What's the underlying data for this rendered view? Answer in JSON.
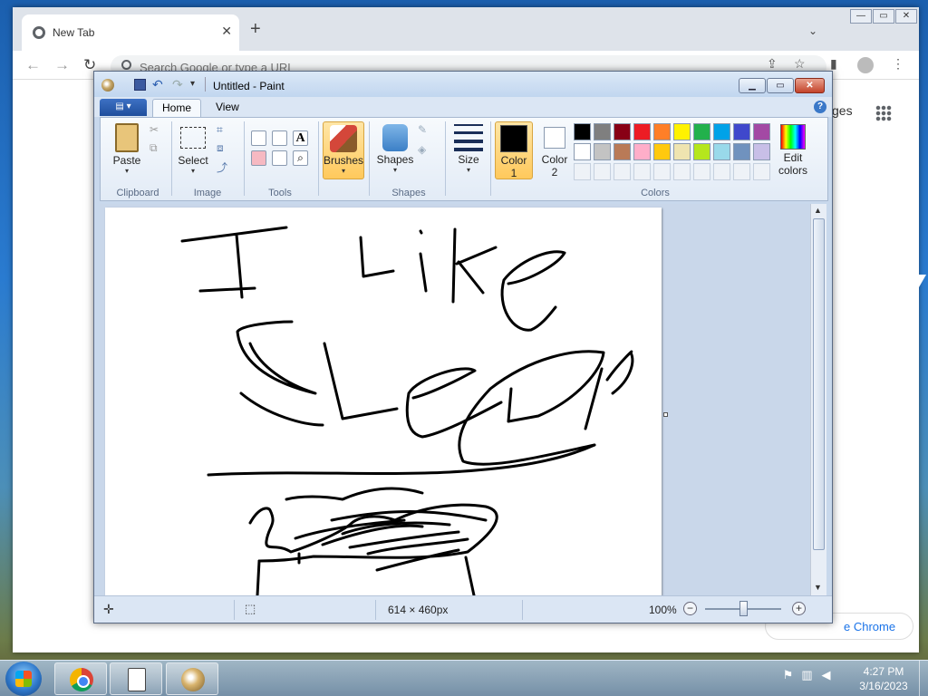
{
  "browser": {
    "tab_title": "New Tab",
    "tab_close": "✕",
    "new_tab": "+",
    "omnibox_placeholder": "Search Google or type a URL",
    "images_link": "ges",
    "customize_label": "e Chrome",
    "caption": {
      "minimize": "—",
      "maximize": "▭",
      "close": "✕"
    }
  },
  "paint": {
    "title": "Untitled - Paint",
    "menu_tabs": {
      "file": "▤ ▾",
      "home": "Home",
      "view": "View"
    },
    "ribbon": {
      "clipboard": {
        "paste": "Paste",
        "group": "Clipboard"
      },
      "image": {
        "select": "Select",
        "group": "Image"
      },
      "tools": {
        "group": "Tools"
      },
      "brushes": "Brushes",
      "shapes": {
        "shapes": "Shapes",
        "group": "Shapes"
      },
      "size": "Size",
      "colors": {
        "color1_label": "Color",
        "color1_num": "1",
        "color2_label": "Color",
        "color2_num": "2",
        "edit_colors_1": "Edit",
        "edit_colors_2": "colors",
        "group": "Colors",
        "color1": "#000000",
        "color2": "#ffffff",
        "palette_row1": [
          "#000000",
          "#7f7f7f",
          "#880015",
          "#ed1c24",
          "#ff7f27",
          "#fff200",
          "#22b14c",
          "#00a2e8",
          "#3f48cc",
          "#a349a4"
        ],
        "palette_row2": [
          "#ffffff",
          "#c3c3c3",
          "#b97a57",
          "#ffaec9",
          "#ffc90e",
          "#efe4b0",
          "#b5e61d",
          "#99d9ea",
          "#7092be",
          "#c8bfe7"
        ]
      }
    },
    "canvas_text": "I Like Sleep",
    "status": {
      "canvas_size": "614 × 460px",
      "zoom": "100%",
      "zoom_minus": "−",
      "zoom_plus": "+"
    }
  },
  "taskbar": {
    "time": "4:27 PM",
    "date": "3/16/2023"
  }
}
